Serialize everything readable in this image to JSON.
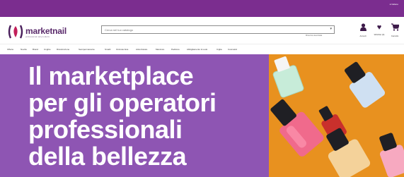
{
  "topbar": {
    "lang_label": "● Italiano"
  },
  "logo": {
    "brand": "marketnail",
    "tagline": "professional nail products"
  },
  "search": {
    "placeholder": "Cerca nel tuo catalogo",
    "hint": "Ricerca avanzata"
  },
  "header_actions": [
    {
      "icon": "user-icon",
      "label": "Accedi"
    },
    {
      "icon": "heart-icon",
      "label": "Wishlist (0)"
    },
    {
      "icon": "cart-icon",
      "label": "Carrello"
    }
  ],
  "nav": {
    "items": [
      "Offerte",
      "Novità",
      "Brand",
      "Unghie",
      "Ricostruzione",
      "Semipermanente",
      "Smalti",
      "Onicotecnica",
      "Attrezzatura",
      "Manicure",
      "Pedicure",
      "Abbigliamento & Look",
      "Ciglia",
      "Cosmetici"
    ]
  },
  "hero": {
    "headline": [
      "Il marketplace",
      "per gli operatori",
      "professionali",
      "della bellezza"
    ]
  },
  "colors": {
    "brand_purple": "#7b2d8f",
    "hero_purple": "#8e55b3",
    "hero_orange": "#e8911f"
  }
}
